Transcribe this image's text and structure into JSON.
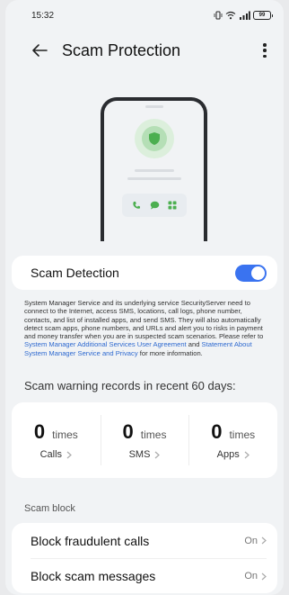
{
  "status_bar": {
    "time": "15:32",
    "battery": "99"
  },
  "header": {
    "title": "Scam Protection"
  },
  "scam_detection": {
    "label": "Scam Detection",
    "enabled": true
  },
  "disclaimer": {
    "text": "System Manager Service and its underlying service SecurityServer need to connect to the Internet, access SMS, locations, call logs, phone number, contacts, and list of installed apps, and send SMS. They will also automatically detect scam apps, phone numbers, and URLs and alert you to risks in payment and money transfer when you are in suspected scam scenarios. Please refer to ",
    "link1": "System Manager Additional Services User Agreement",
    "and": " and ",
    "link2": "Statement About System Manager Service and Privacy",
    "suffix": " for more information."
  },
  "warning_records": {
    "heading": "Scam warning records in recent 60 days:",
    "unit": "times",
    "stats": [
      {
        "count": "0",
        "label": "Calls"
      },
      {
        "count": "0",
        "label": "SMS"
      },
      {
        "count": "0",
        "label": "Apps"
      }
    ]
  },
  "scam_block": {
    "heading": "Scam block",
    "rows": [
      {
        "label": "Block fraudulent calls",
        "status": "On"
      },
      {
        "label": "Block scam messages",
        "status": "On"
      }
    ]
  },
  "colors": {
    "accent": "#3a73f0",
    "shield": "#4caf50",
    "link": "#2f6ad0"
  },
  "icons": [
    "back-arrow-icon",
    "more-vertical-icon",
    "shield-icon",
    "phone-icon",
    "message-icon",
    "apps-icon",
    "chevron-right-icon"
  ]
}
